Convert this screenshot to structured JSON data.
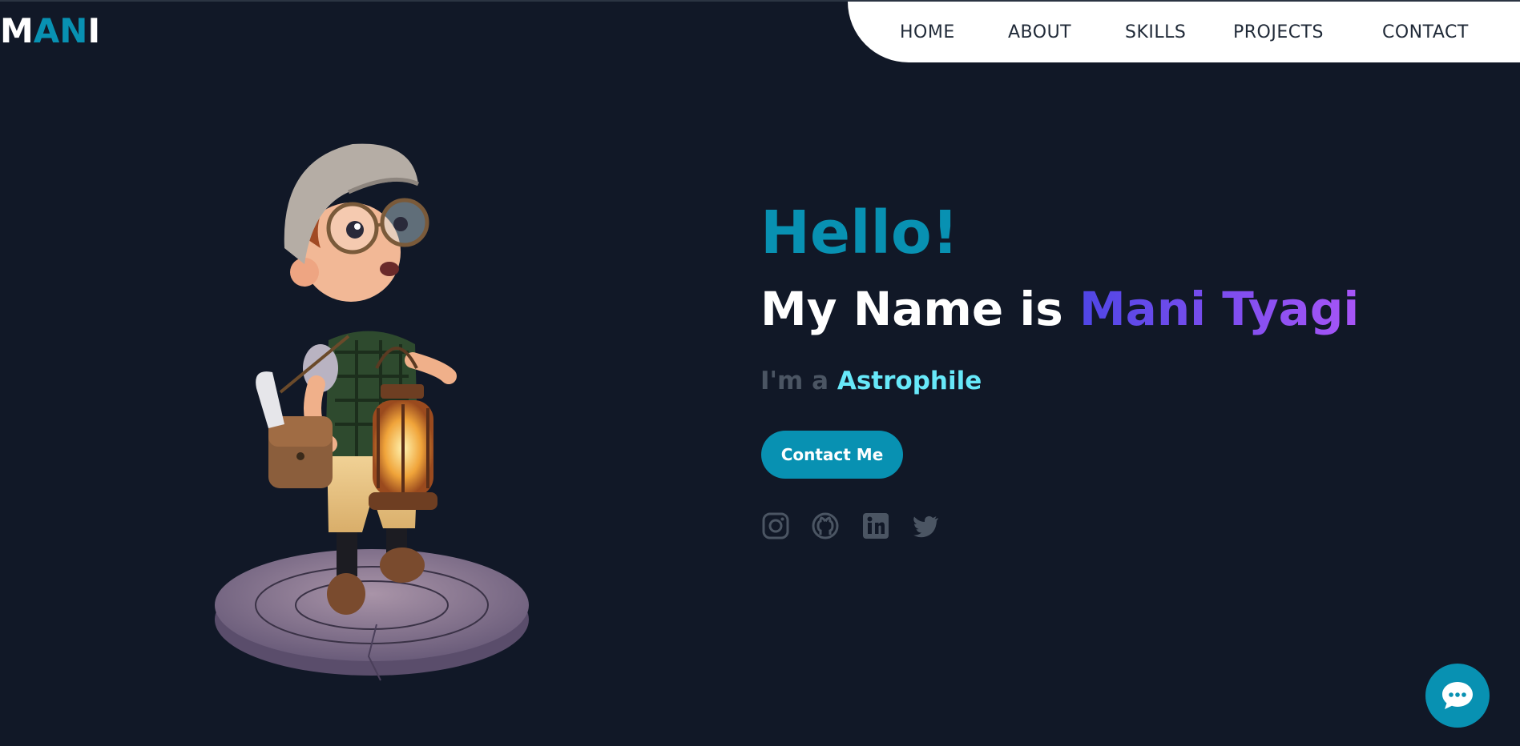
{
  "logo": {
    "part1": "M",
    "part2": "AN",
    "part3": "I"
  },
  "nav": {
    "items": [
      {
        "label": "HOME"
      },
      {
        "label": "ABOUT"
      },
      {
        "label": "SKILLS"
      },
      {
        "label": "PROJECTS"
      },
      {
        "label": "CONTACT"
      }
    ]
  },
  "hero": {
    "greeting": "Hello!",
    "name_prefix": "My Name is ",
    "name": "Mani Tyagi",
    "role_prefix": "I'm a ",
    "role": "Astrophile",
    "contact_button": "Contact Me",
    "image": "cartoon-boy-with-lantern"
  },
  "social": [
    {
      "icon": "instagram-icon"
    },
    {
      "icon": "github-icon"
    },
    {
      "icon": "linkedin-icon"
    },
    {
      "icon": "twitter-icon"
    }
  ],
  "chat": {
    "icon": "chat-bubble-icon"
  },
  "colors": {
    "background": "#111827",
    "accent": "#0891b2",
    "gradient_start": "#4f46e5",
    "gradient_end": "#a855f7",
    "role": "#67e8f9",
    "muted": "#4b5563"
  }
}
